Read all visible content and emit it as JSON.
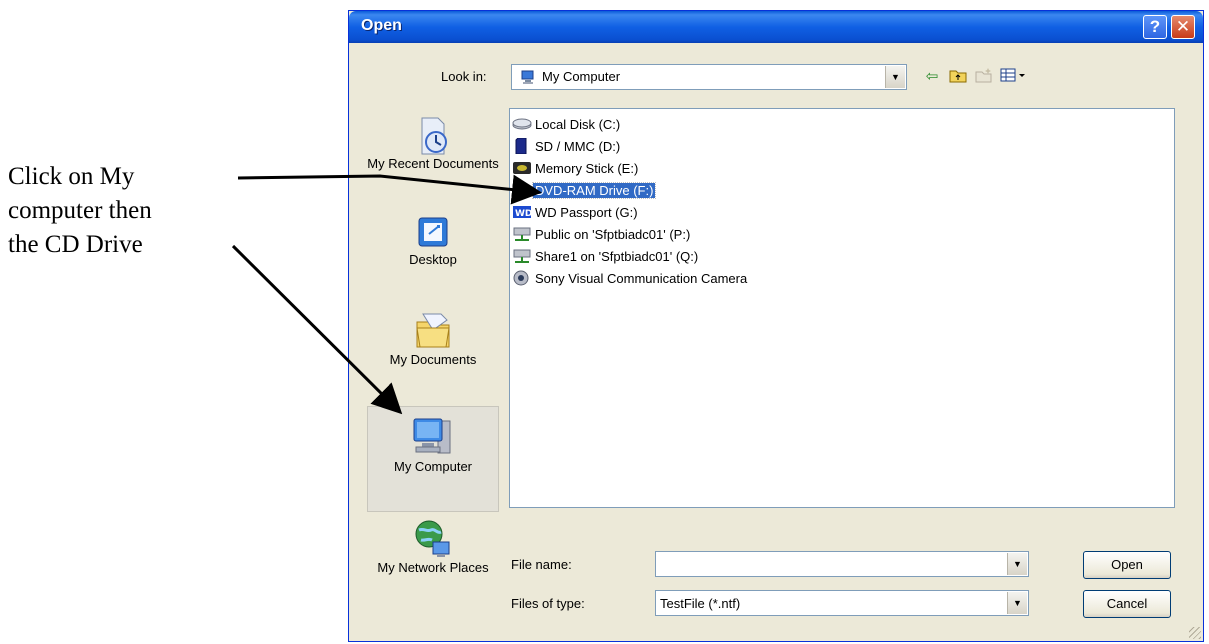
{
  "annotation": {
    "lines": [
      "Click on My",
      "computer then",
      "the CD Drive"
    ]
  },
  "dialog": {
    "title": "Open",
    "help_label": "?",
    "close_label": "✕",
    "look_in_label": "Look in:",
    "look_in_value": "My Computer"
  },
  "places": [
    {
      "label": "My Recent Documents",
      "icon": "recent-documents-icon"
    },
    {
      "label": "Desktop",
      "icon": "desktop-icon"
    },
    {
      "label": "My Documents",
      "icon": "my-documents-icon"
    },
    {
      "label": "My Computer",
      "icon": "my-computer-icon",
      "selected": true
    },
    {
      "label": "My Network Places",
      "icon": "network-places-icon"
    }
  ],
  "files": [
    {
      "label": "Local Disk (C:)",
      "icon": "hard-disk-icon"
    },
    {
      "label": "SD / MMC (D:)",
      "icon": "sd-card-icon"
    },
    {
      "label": "Memory Stick (E:)",
      "icon": "memory-stick-icon"
    },
    {
      "label": "DVD-RAM Drive (F:)",
      "icon": "dvd-drive-icon",
      "selected": true
    },
    {
      "label": "WD Passport (G:)",
      "icon": "wd-drive-icon"
    },
    {
      "label": "Public on 'Sfptbiadc01' (P:)",
      "icon": "network-drive-icon"
    },
    {
      "label": "Share1 on 'Sfptbiadc01' (Q:)",
      "icon": "network-drive-icon"
    },
    {
      "label": "Sony Visual Communication Camera",
      "icon": "camera-icon"
    }
  ],
  "bottom": {
    "file_name_label": "File name:",
    "file_name_value": "",
    "files_of_type_label": "Files of type:",
    "files_of_type_value": "TestFile (*.ntf)",
    "open_label": "Open",
    "cancel_label": "Cancel"
  },
  "colors": {
    "selection": "#316ac5",
    "title_bar": "#0a5bd9",
    "dialog_bg": "#ece9d8"
  }
}
